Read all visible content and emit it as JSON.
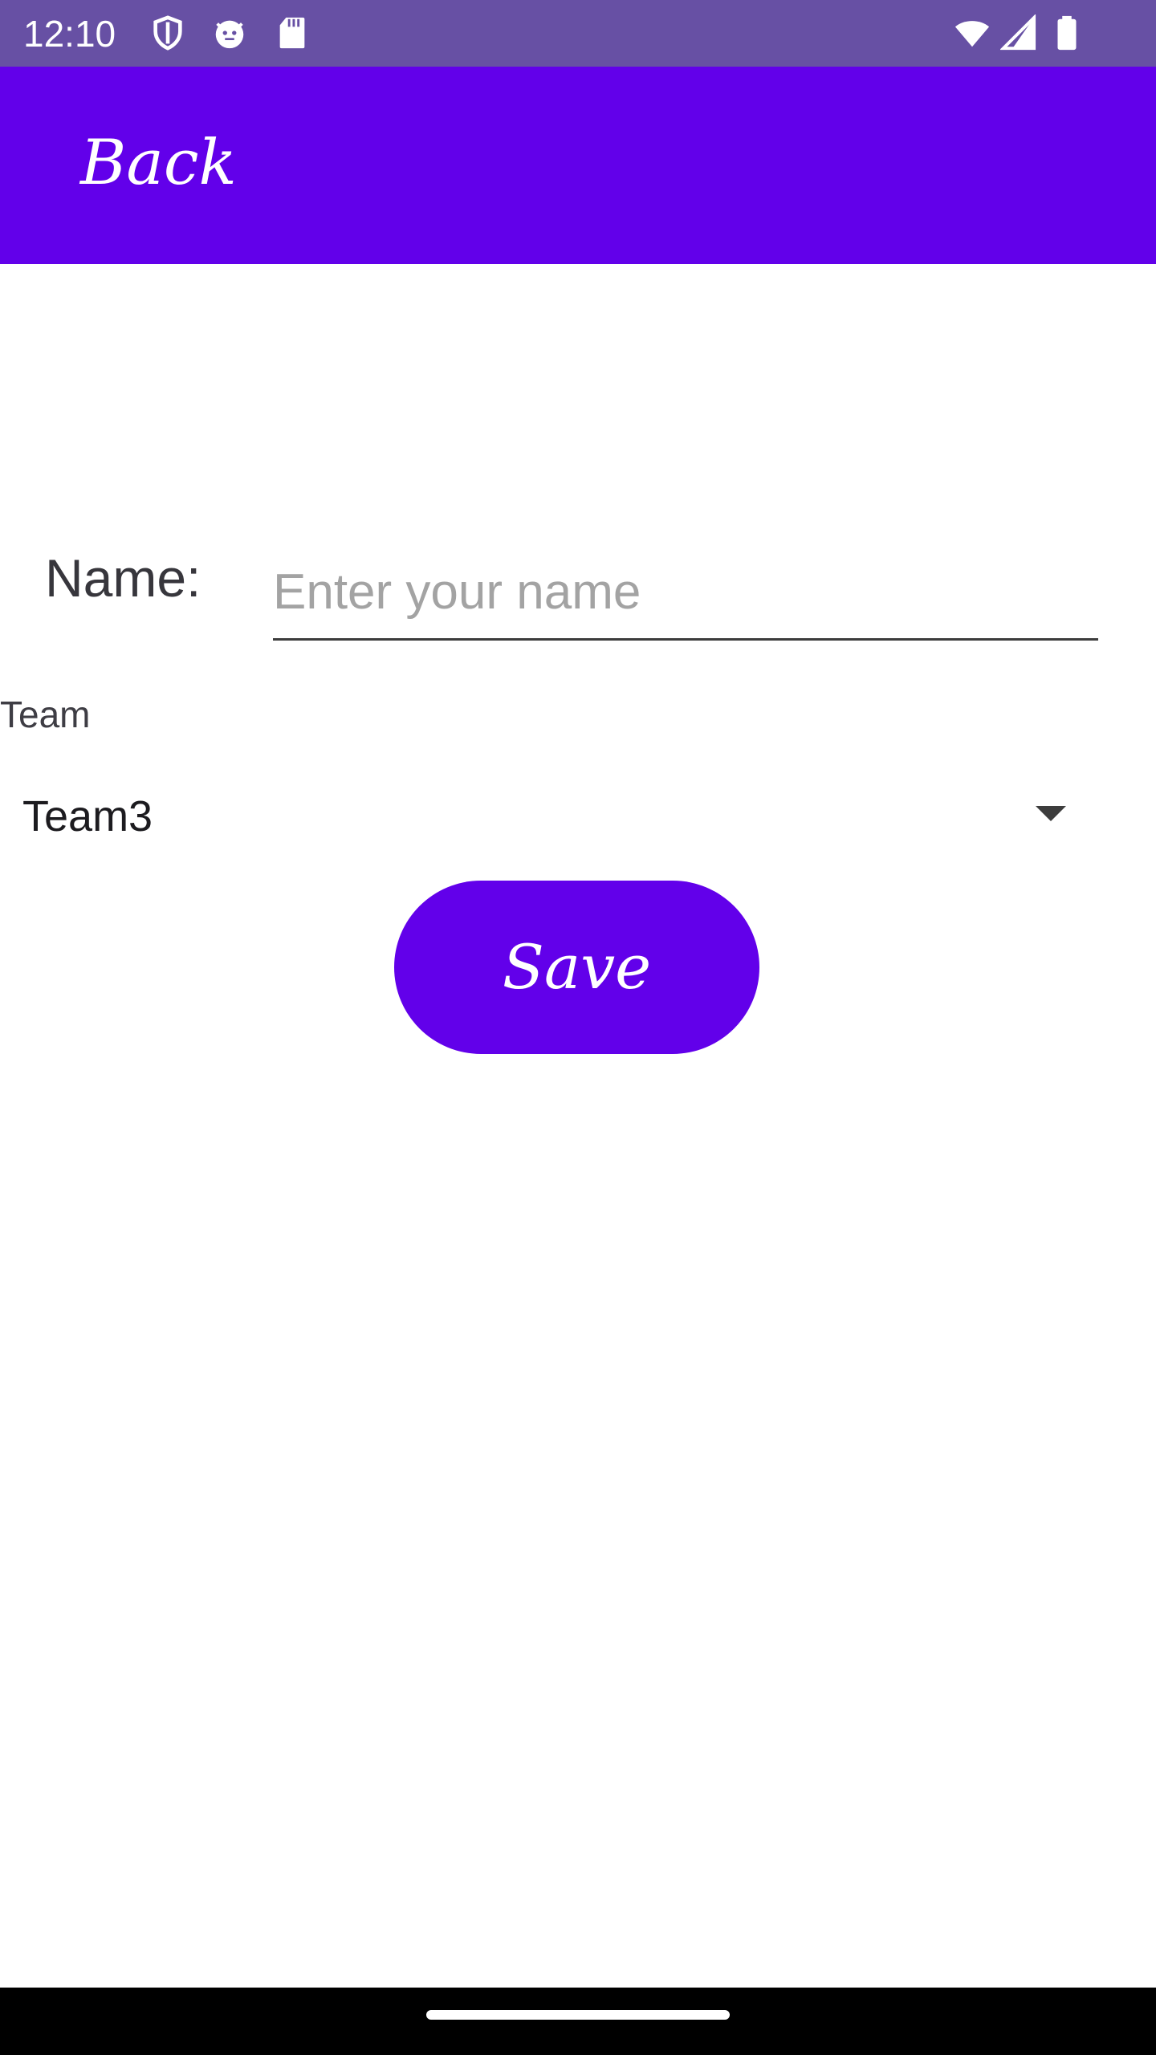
{
  "status_bar": {
    "time": "12:10",
    "left_icons": [
      "shield-icon",
      "cat-face-icon",
      "sd-card-icon"
    ],
    "right_icons": [
      "wifi-icon",
      "cellular-signal-icon",
      "battery-icon"
    ],
    "background_color": "#6750a4"
  },
  "app_bar": {
    "back_label": "Back",
    "background_color": "#6200ea"
  },
  "form": {
    "name_label": "Name:",
    "name_placeholder": "Enter your name",
    "name_value": "",
    "team_label": "Team",
    "team_selected": "Team3",
    "save_label": "Save"
  },
  "colors": {
    "accent": "#6200ea",
    "text_primary": "#1c1b1f",
    "placeholder": "#a3a3a3"
  }
}
